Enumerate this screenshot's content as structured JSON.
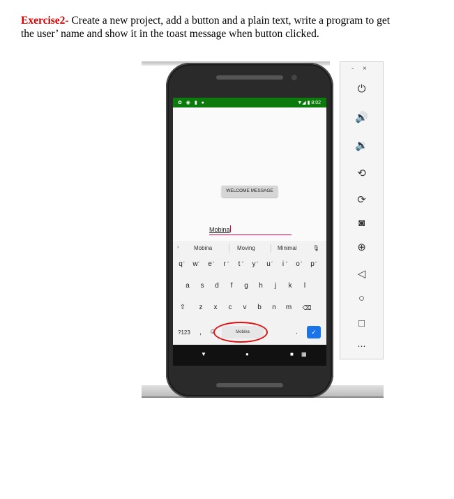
{
  "document": {
    "exercise_title": "Exercise2-",
    "line1": "Create a new project, add a button and a plain text, write a program to get",
    "line2": "the user’ name and show it in the toast message when button clicked."
  },
  "phone": {
    "status_time": "8:02",
    "welcome_button_label": "WELCOME MESSAGE",
    "name_input_value": "Mobina",
    "suggestions": [
      "Mobina",
      "Moving",
      "Minimal"
    ],
    "keyboard_rows": [
      [
        "q",
        "w",
        "e",
        "r",
        "t",
        "y",
        "u",
        "i",
        "o",
        "p"
      ],
      [
        "a",
        "s",
        "d",
        "f",
        "g",
        "h",
        "j",
        "k",
        "l"
      ],
      [
        "z",
        "x",
        "c",
        "v",
        "b",
        "n",
        "m"
      ]
    ],
    "number_hints": [
      "1",
      "2",
      "3",
      "4",
      "5",
      "6",
      "7",
      "8",
      "9",
      "0"
    ],
    "symbols_key": "?123",
    "comma_key": ",",
    "period_key": ".",
    "space_suggestion": "Mobina"
  },
  "toolbar": {
    "minimize": "-",
    "close": "×"
  },
  "colors": {
    "status_bar": "#0d7a0d",
    "input_underline": "#d6004c",
    "annotation_ring": "#e01010",
    "enter_key": "#1a73e8"
  }
}
